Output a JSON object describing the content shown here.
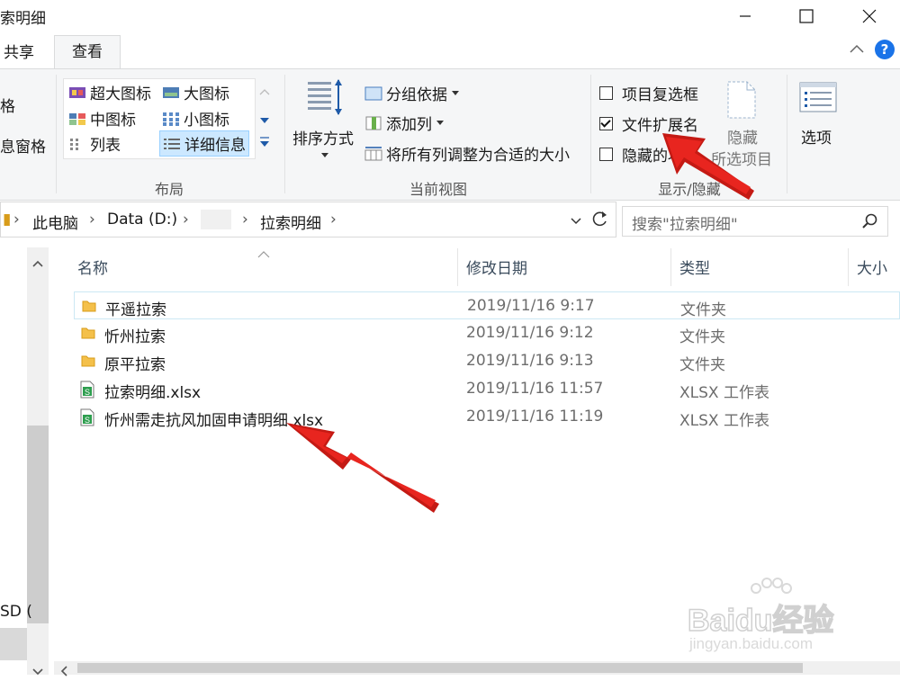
{
  "window": {
    "title": "索明细",
    "minimize_icon": "minimize-icon",
    "maximize_icon": "maximize-icon",
    "close_icon": "close-icon"
  },
  "tabs": {
    "share": "共享",
    "view": "查看"
  },
  "ribbon": {
    "left_partial_1": "格",
    "left_partial_2": "息窗格",
    "layout": {
      "items": [
        "超大图标",
        "大图标",
        "中图标",
        "小图标",
        "列表",
        "详细信息"
      ],
      "label": "布局"
    },
    "current_view": {
      "sort_label": "排序方式",
      "group_by": "分组依据",
      "add_column": "添加列",
      "fit_columns": "将所有列调整为合适的大小",
      "label": "当前视图"
    },
    "show_hide": {
      "item_checkboxes": "项目复选框",
      "file_extensions": "文件扩展名",
      "hidden_items": "隐藏的项目",
      "hide_selected_line1": "隐藏",
      "hide_selected_line2": "所选项目",
      "label": "显示/隐藏",
      "item_checkboxes_checked": false,
      "file_extensions_checked": true,
      "hidden_items_checked": false
    },
    "options": "选项"
  },
  "address": {
    "crumbs": [
      "此电脑",
      "Data (D:)",
      "拉索明细"
    ],
    "search_placeholder": "搜索\"拉索明细\""
  },
  "nav": {
    "partial_drive": "SD ("
  },
  "columns": {
    "name": "名称",
    "modified": "修改日期",
    "type": "类型",
    "size": "大小"
  },
  "files": [
    {
      "name": "平遥拉索",
      "modified": "2019/11/16 9:17",
      "type": "文件夹",
      "icon": "folder-icon"
    },
    {
      "name": "忻州拉索",
      "modified": "2019/11/16 9:12",
      "type": "文件夹",
      "icon": "folder-icon"
    },
    {
      "name": "原平拉索",
      "modified": "2019/11/16 9:13",
      "type": "文件夹",
      "icon": "folder-icon"
    },
    {
      "name": "拉索明细.xlsx",
      "modified": "2019/11/16 11:57",
      "type": "XLSX 工作表",
      "icon": "spreadsheet-icon"
    },
    {
      "name": "忻州需走抗风加固申请明细.xlsx",
      "modified": "2019/11/16 11:19",
      "type": "XLSX 工作表",
      "icon": "spreadsheet-icon"
    }
  ],
  "watermark": {
    "line1": "Baidu经验",
    "line2": "jingyan.baidu.com"
  },
  "colors": {
    "accent": "#1a73e8",
    "arrow": "#e8251f",
    "selection": "#cce8ff"
  }
}
